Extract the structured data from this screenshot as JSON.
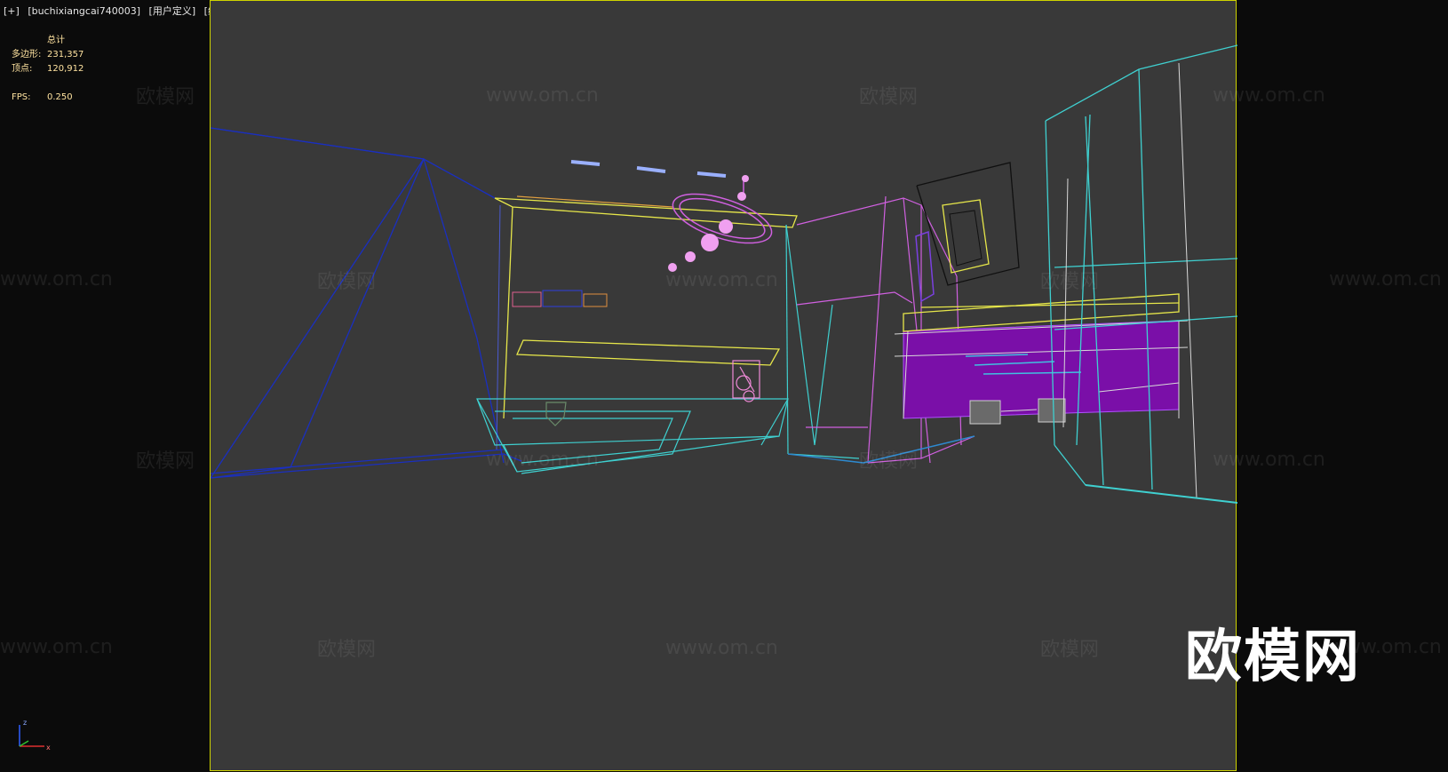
{
  "viewport": {
    "tags": [
      "[+]",
      "[buchixiangcai740003]",
      "[用户定义]",
      "[线框]"
    ]
  },
  "stats": {
    "title": "总计",
    "polygons_label": "多边形:",
    "polygons_value": "231,357",
    "vertices_label": "顶点:",
    "vertices_value": "120,912",
    "fps_label": "FPS:",
    "fps_value": "0.250"
  },
  "watermarks": {
    "text_cn": "欧模网",
    "text_en": "www.om.cn"
  },
  "logo": {
    "text": "欧模网"
  },
  "gizmo": {
    "x_label": "x",
    "z_label": "z"
  },
  "colors": {
    "viewport_bg": "#393939",
    "viewport_border": "#cfd400",
    "stats_text": "#ffe3a0",
    "wire_blue": "#1a2fc0",
    "wire_cyan": "#3fd0d0",
    "wire_yellow": "#e6e64a",
    "wire_magenta": "#d060e0",
    "wire_purple_fill": "#7a0fa8"
  }
}
